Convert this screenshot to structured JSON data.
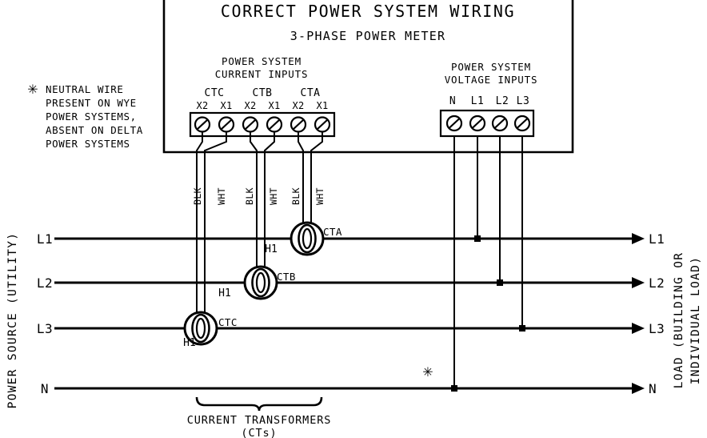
{
  "diagram": {
    "title": "CORRECT POWER SYSTEM WIRING",
    "subtitle": "3-PHASE POWER METER",
    "note": {
      "symbol": "✳",
      "lines": [
        "NEUTRAL WIRE",
        "PRESENT ON WYE",
        "POWER SYSTEMS,",
        "ABSENT ON DELTA",
        "POWER SYSTEMS"
      ]
    },
    "current_inputs": {
      "heading_line1": "POWER SYSTEM",
      "heading_line2": "CURRENT INPUTS",
      "groups": [
        {
          "name": "CTC",
          "terminals": [
            "X2",
            "X1"
          ]
        },
        {
          "name": "CTB",
          "terminals": [
            "X2",
            "X1"
          ]
        },
        {
          "name": "CTA",
          "terminals": [
            "X2",
            "X1"
          ]
        }
      ]
    },
    "voltage_inputs": {
      "heading_line1": "POWER SYSTEM",
      "heading_line2": "VOLTAGE INPUTS",
      "terminals": [
        "N",
        "L1",
        "L2",
        "L3"
      ]
    },
    "wire_labels": [
      "BLK",
      "WHT",
      "BLK",
      "WHT",
      "BLK",
      "WHT"
    ],
    "current_transformers": [
      {
        "name": "CTA",
        "polarity": "H1",
        "phase": "L1"
      },
      {
        "name": "CTB",
        "polarity": "H1",
        "phase": "L2"
      },
      {
        "name": "CTC",
        "polarity": "H1",
        "phase": "L3"
      }
    ],
    "source_label": "POWER SOURCE (UTILITY)",
    "load_label_line1": "LOAD (BUILDING OR",
    "load_label_line2": "INDIVIDUAL LOAD)",
    "source_lines": [
      "L1",
      "L2",
      "L3",
      "N"
    ],
    "load_lines": [
      "L1",
      "L2",
      "L3",
      "N"
    ],
    "neutral_marker": "✳",
    "caption_line1": "CURRENT TRANSFORMERS",
    "caption_line2": "(CTs)",
    "colors": {
      "ink": "#000000",
      "background": "#ffffff"
    }
  }
}
